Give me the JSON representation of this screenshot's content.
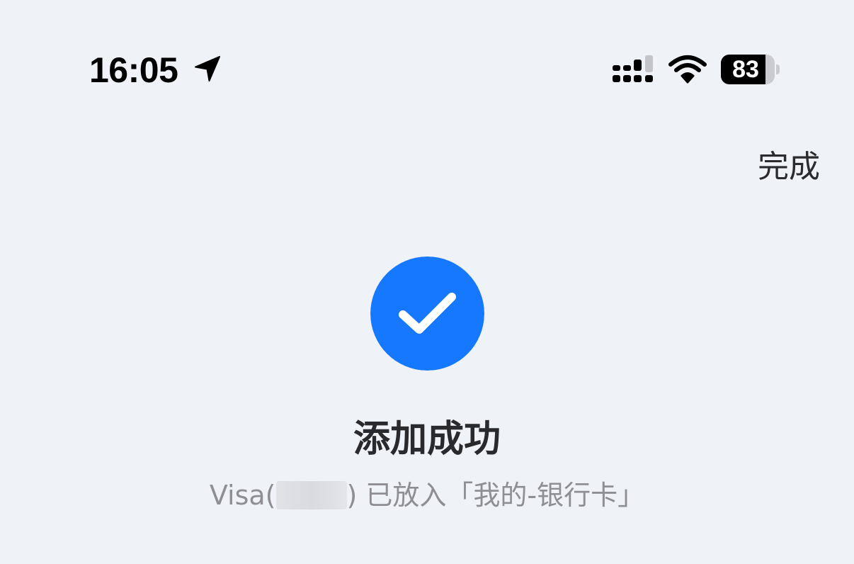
{
  "status_bar": {
    "time": "16:05",
    "battery_level": "83",
    "battery_fraction": 0.83,
    "icons": [
      "location-arrow-icon",
      "cellular-signal-icon",
      "wifi-icon",
      "battery-icon"
    ]
  },
  "nav": {
    "done_label": "完成"
  },
  "result": {
    "icon": "checkmark-circle-icon",
    "icon_color": "#1677ff",
    "title": "添加成功",
    "card_brand": "Visa",
    "card_open_paren": "(",
    "card_close_paren": ")",
    "message": " 已放入「我的-银行卡」"
  },
  "colors": {
    "background": "#eff2f7",
    "accent": "#1677ff",
    "secondary_text": "#8e8e93"
  }
}
